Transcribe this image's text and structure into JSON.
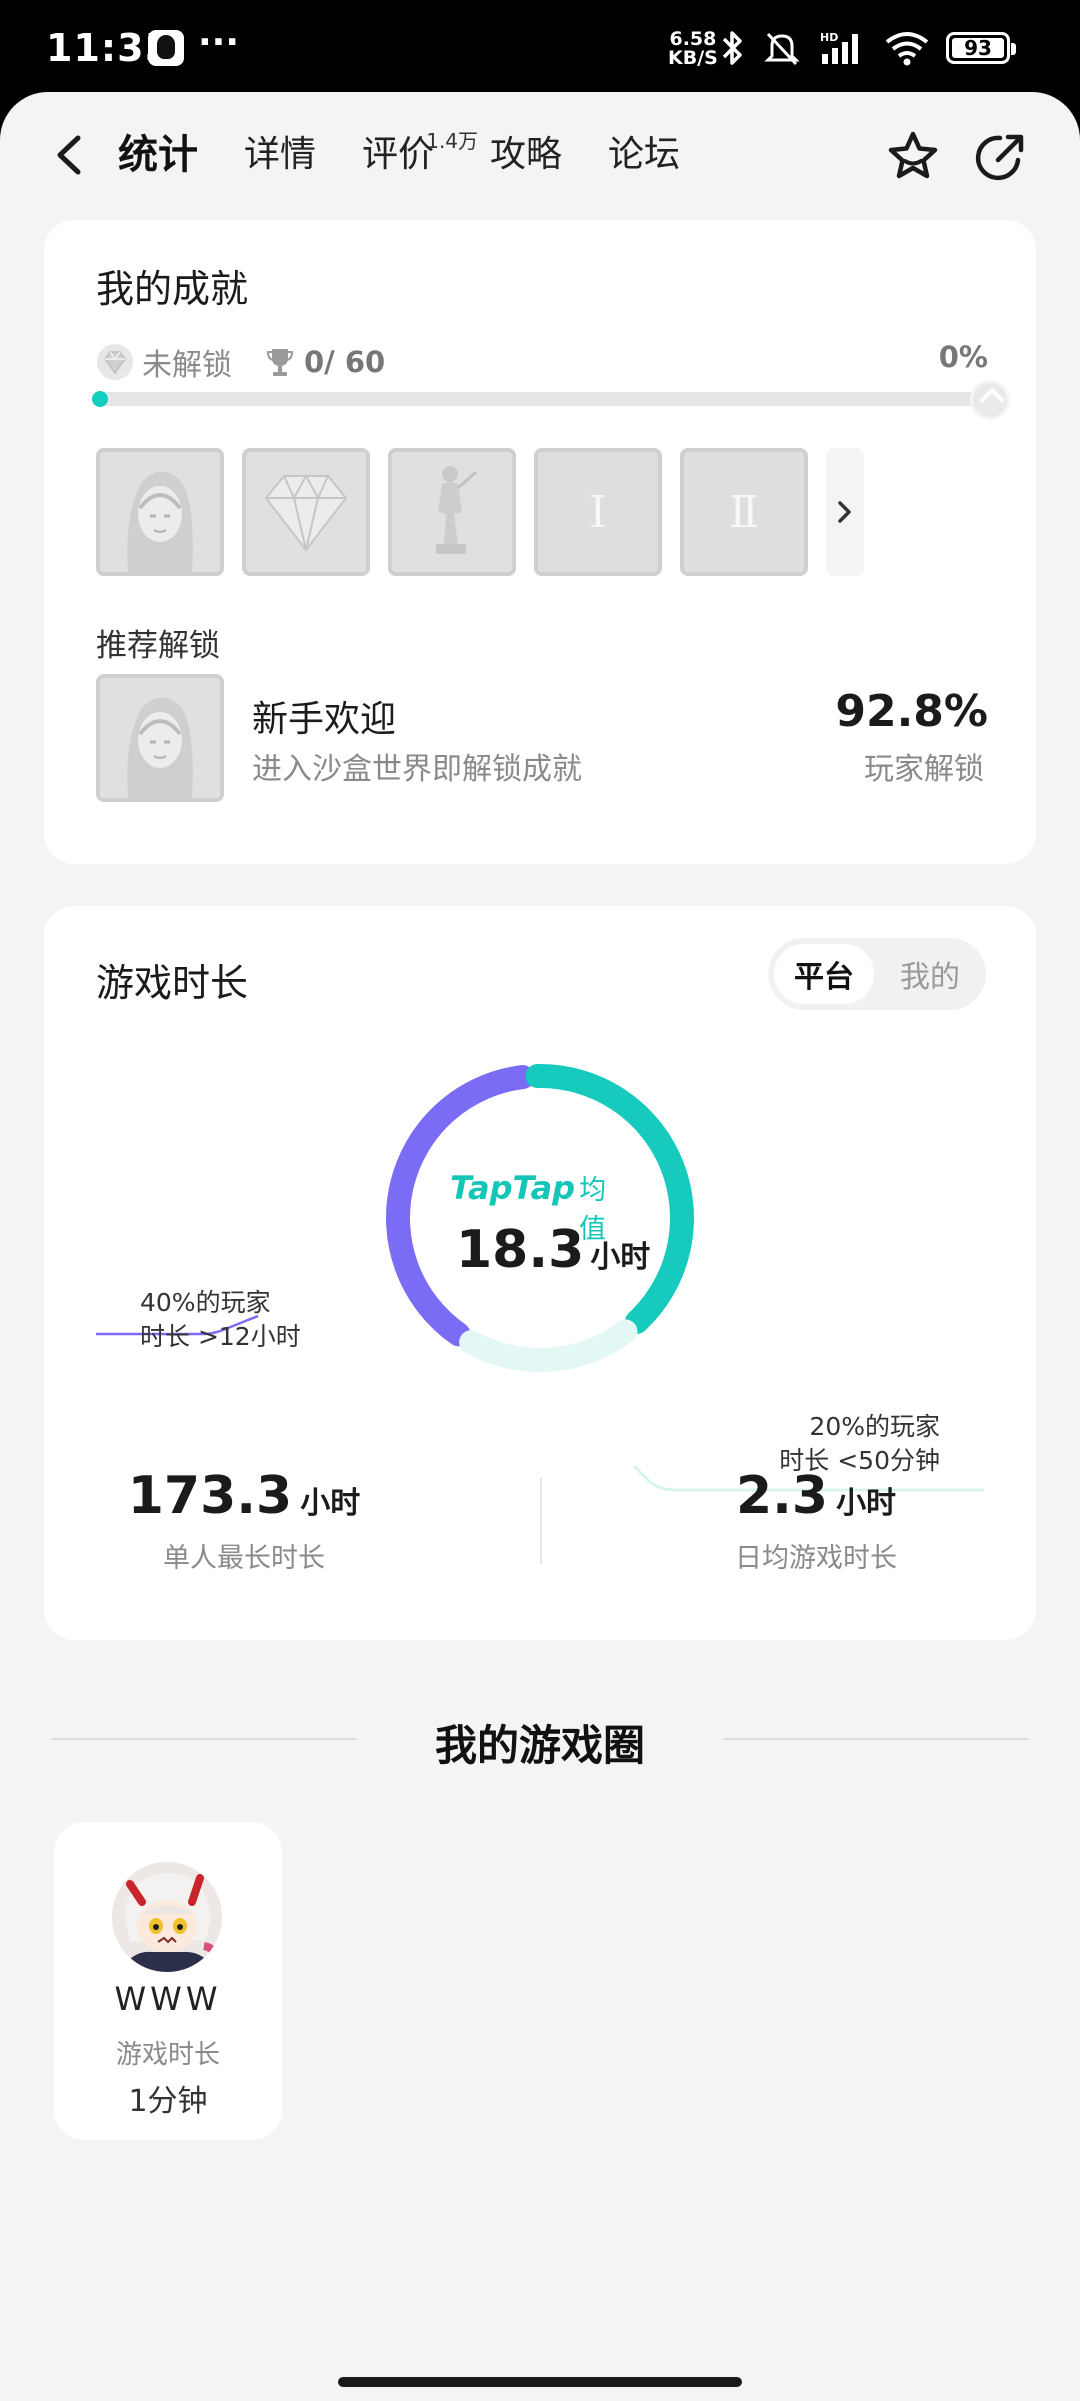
{
  "status_bar": {
    "time": "11:35",
    "more": "···",
    "net_speed_value": "6.58",
    "net_speed_unit": "KB/S",
    "battery": "93"
  },
  "nav": {
    "tabs": [
      {
        "label": "统计",
        "active": true
      },
      {
        "label": "详情"
      },
      {
        "label": "评价",
        "superscript": "1.4万"
      },
      {
        "label": "攻略"
      },
      {
        "label": "论坛"
      }
    ],
    "icons": [
      "back-arrow-icon",
      "star-icon",
      "share-icon"
    ]
  },
  "achievements": {
    "title": "我的成就",
    "status_label": "未解锁",
    "count": "0/ 60",
    "percent": "0%",
    "progress_fraction": 0.0,
    "badges": [
      {
        "kind": "portrait"
      },
      {
        "kind": "gem"
      },
      {
        "kind": "statue"
      },
      {
        "kind": "numeral",
        "text": "Ⅰ"
      },
      {
        "kind": "numeral",
        "text": "Ⅱ"
      }
    ],
    "recommend_label": "推荐解锁",
    "recommend": {
      "name": "新手欢迎",
      "desc": "进入沙盒世界即解锁成就",
      "percent": "92.8%",
      "percent_label": "玩家解锁"
    }
  },
  "play_time": {
    "title": "游戏时长",
    "toggle": {
      "active": "平台",
      "inactive": "我的"
    },
    "brand": "TapTap",
    "brand_suffix": "均值",
    "avg_value": "18.3",
    "avg_unit": "小时",
    "left_callout": {
      "line1": "40%的玩家",
      "line2": "时长 >12小时"
    },
    "right_callout": {
      "line1": "20%的玩家",
      "line2": "时长 <50分钟"
    },
    "segments": [
      {
        "share": 0.4,
        "color": "#7a6cf5"
      },
      {
        "share": 0.4,
        "color": "#16cbbd"
      },
      {
        "share": 0.2,
        "color": "#e3f7f5"
      }
    ],
    "stats": [
      {
        "value": "173.3",
        "unit": "小时",
        "label": "单人最长时长"
      },
      {
        "value": "2.3",
        "unit": "小时",
        "label": "日均游戏时长"
      }
    ]
  },
  "game_circle": {
    "title": "我的游戏圈",
    "members": [
      {
        "name": "WWW",
        "meta_label": "游戏时长",
        "value": "1分钟"
      }
    ]
  }
}
